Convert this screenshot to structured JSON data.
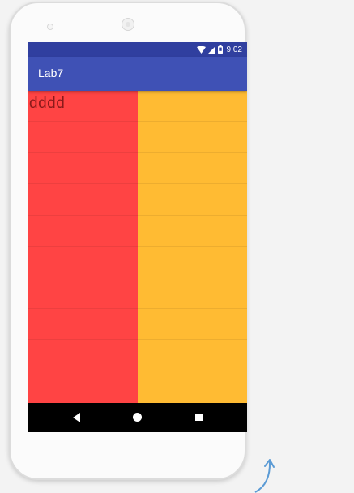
{
  "status_bar": {
    "time": "9:02",
    "icons": [
      "wifi-icon",
      "cell-signal-icon",
      "battery-icon"
    ]
  },
  "app_bar": {
    "title": "Lab7"
  },
  "content": {
    "left_column": {
      "color": "#ff4444",
      "first_item_text": "dddd"
    },
    "right_column": {
      "color": "#ffbb33"
    }
  },
  "nav_bar": {
    "icons": [
      "back-icon",
      "home-icon",
      "recents-icon"
    ]
  },
  "colors": {
    "status_bar": "#303f9f",
    "app_bar": "#3f51b5",
    "rotate_arrow": "#5b9bd5"
  }
}
